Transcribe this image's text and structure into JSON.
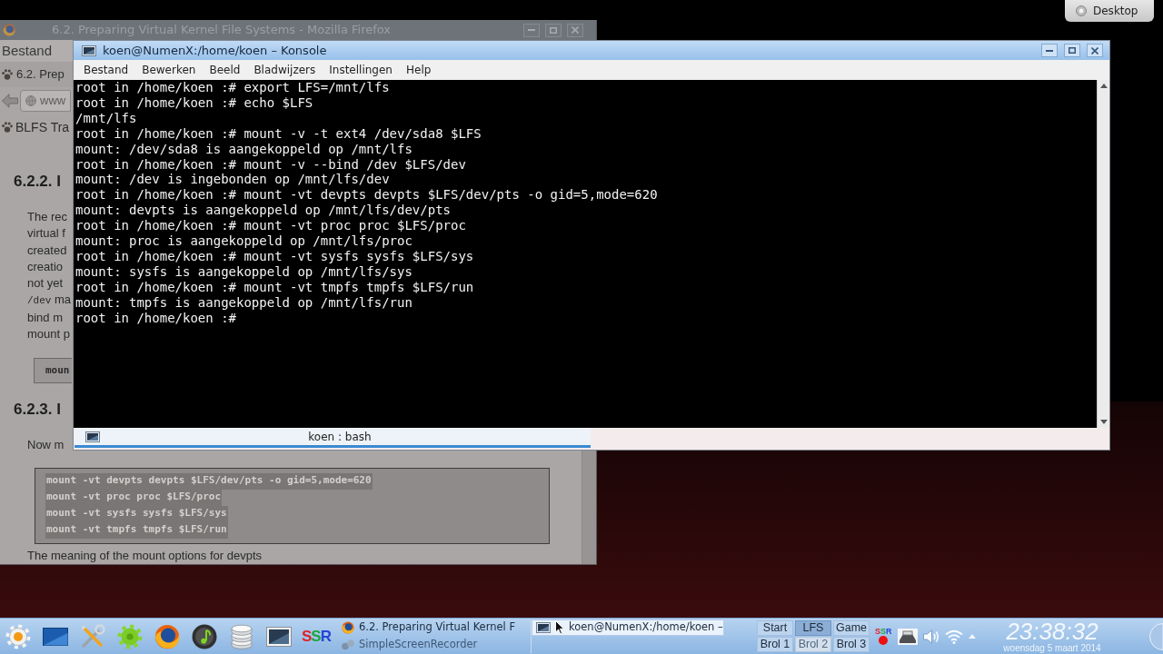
{
  "desktop": {
    "toolbox_label": "Desktop"
  },
  "browser_window": {
    "active": false,
    "title": "6.2. Preparing Virtual Kernel File Systems - Mozilla Firefox",
    "menu": [
      "Bestand"
    ],
    "tab": "6.2. Prep",
    "address": "www",
    "bookmark": "BLFS Tra",
    "content": [
      {
        "kind": "heading",
        "text": "6.2.2. I"
      },
      {
        "kind": "paragraph",
        "lines": [
          {
            "text": "The rec"
          },
          {
            "text": "virtual f"
          },
          {
            "text": "created"
          },
          {
            "text": "creatio"
          },
          {
            "text": "not yet"
          },
          {
            "code": "/dev",
            "text": "ma"
          },
          {
            "text": "bind m"
          },
          {
            "text": "mount p"
          }
        ]
      },
      {
        "kind": "command",
        "text": "moun"
      },
      {
        "kind": "heading",
        "text": "6.2.3. I"
      },
      {
        "kind": "paragraph",
        "lines": [
          {
            "text": "Now m"
          }
        ]
      },
      {
        "kind": "code",
        "selected": true,
        "lines": [
          "mount -vt devpts devpts $LFS/dev/pts -o gid=5,mode=620",
          "mount -vt proc proc $LFS/proc",
          "mount -vt sysfs sysfs $LFS/sys",
          "mount -vt tmpfs tmpfs $LFS/run"
        ]
      },
      {
        "kind": "paragraph",
        "lines": [
          {
            "text": "The meaning of the mount options for devpts"
          }
        ]
      }
    ]
  },
  "terminal_window": {
    "active": true,
    "title": "koen@NumenX:/home/koen – Konsole",
    "menu": [
      "Bestand",
      "Bewerken",
      "Beeld",
      "Bladwijzers",
      "Instellingen",
      "Help"
    ],
    "lines": [
      "root in /home/koen :# export LFS=/mnt/lfs",
      "root in /home/koen :# echo $LFS",
      "/mnt/lfs",
      "root in /home/koen :# mount -v -t ext4 /dev/sda8 $LFS",
      "mount: /dev/sda8 is aangekoppeld op /mnt/lfs",
      "root in /home/koen :# mount -v --bind /dev $LFS/dev",
      "mount: /dev is ingebonden op /mnt/lfs/dev",
      "root in /home/koen :# mount -vt devpts devpts $LFS/dev/pts -o gid=5,mode=620",
      "mount: devpts is aangekoppeld op /mnt/lfs/dev/pts",
      "root in /home/koen :# mount -vt proc proc $LFS/proc",
      "mount: proc is aangekoppeld op /mnt/lfs/proc",
      "root in /home/koen :# mount -vt sysfs sysfs $LFS/sys",
      "mount: sysfs is aangekoppeld op /mnt/lfs/sys",
      "root in /home/koen :# mount -vt tmpfs tmpfs $LFS/run",
      "mount: tmpfs is aangekoppeld op /mnt/lfs/run",
      "root in /home/koen :#"
    ],
    "tabs": [
      {
        "label": "koen : bash",
        "selected": true
      }
    ]
  },
  "taskbar": {
    "launcher_logo": "SSR",
    "tasks": [
      {
        "kind": "browser",
        "title": "6.2. Preparing Virtual Kernel F",
        "selected": false,
        "minimized": false
      },
      {
        "kind": "terminal",
        "title": "koen@NumenX:/home/koen –",
        "selected": true,
        "minimized": false
      },
      {
        "kind": "recorder",
        "title": "SimpleScreenRecorder",
        "selected": false,
        "minimized": true
      }
    ],
    "pager": [
      {
        "label": "Start",
        "selected": false,
        "dimmed": false
      },
      {
        "label": "LFS",
        "selected": true,
        "dimmed": false
      },
      {
        "label": "Game",
        "selected": false,
        "dimmed": false
      },
      {
        "label": "Brol 1",
        "selected": false,
        "dimmed": false
      },
      {
        "label": "Brol 2",
        "selected": false,
        "dimmed": true
      },
      {
        "label": "Brol 3",
        "selected": false,
        "dimmed": false
      }
    ],
    "tray": {
      "recorder_logo": "SSR",
      "recording": true
    },
    "clock": {
      "time": "23:38:32",
      "date": "woensdag 5 maart 2014"
    }
  }
}
